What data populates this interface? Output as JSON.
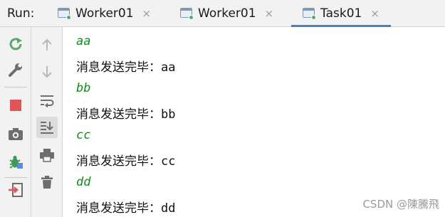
{
  "run_label": "Run:",
  "tabs": [
    {
      "label": "Worker01",
      "close": "×",
      "active": false
    },
    {
      "label": "Worker01",
      "close": "×",
      "active": false
    },
    {
      "label": "Task01",
      "close": "×",
      "active": true
    }
  ],
  "toolbar_left": [
    "rerun-icon",
    "wrench-icon",
    "stop-icon",
    "camera-icon",
    "debug-icon",
    "exit-icon"
  ],
  "toolbar_right": [
    "up-arrow-icon",
    "down-arrow-icon",
    "soft-wrap-icon",
    "scroll-to-end-icon",
    "print-icon",
    "trash-icon"
  ],
  "console": {
    "lines": [
      {
        "kind": "input",
        "text": "aa"
      },
      {
        "kind": "output",
        "prefix": "消息发送完毕：",
        "value": "aa"
      },
      {
        "kind": "input",
        "text": "bb"
      },
      {
        "kind": "output",
        "prefix": "消息发送完毕：",
        "value": "bb"
      },
      {
        "kind": "input",
        "text": "cc"
      },
      {
        "kind": "output",
        "prefix": "消息发送完毕：",
        "value": "cc"
      },
      {
        "kind": "input",
        "text": "dd"
      },
      {
        "kind": "output",
        "prefix": "消息发送完毕：",
        "value": "dd"
      }
    ]
  },
  "watermark": "CSDN @陳騰飛",
  "colors": {
    "input_text": "#17891b",
    "tab_active_underline": "#4083c9",
    "stop_red": "#e05555",
    "rerun_green": "#59a869"
  }
}
